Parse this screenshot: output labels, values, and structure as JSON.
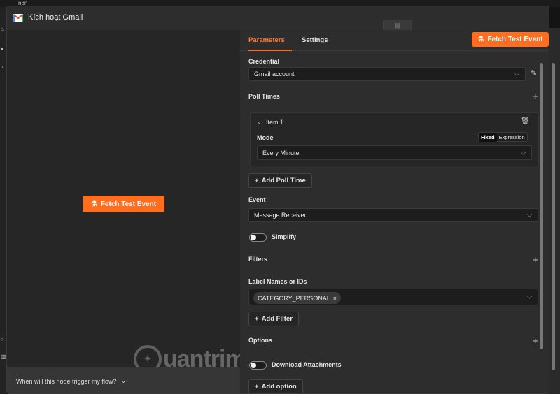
{
  "window": {
    "title": "Kích hoạt Gmail"
  },
  "background": {
    "top_text": "n8n"
  },
  "left_pane": {
    "fetch_button": "Fetch Test Event",
    "faq_text": "When will this node trigger my flow?",
    "watermark": "uantrimang"
  },
  "tabs": [
    {
      "label": "Parameters"
    },
    {
      "label": "Settings"
    }
  ],
  "fetch_button": "Fetch Test Event",
  "credential": {
    "label": "Credential",
    "value": "Gmail account"
  },
  "poll_times": {
    "label": "Poll Times",
    "item_label": "Item 1",
    "mode_label": "Mode",
    "mode_options": [
      "Fixed",
      "Expression"
    ],
    "mode_value": "Every Minute",
    "add_button": "Add Poll Time"
  },
  "event": {
    "label": "Event",
    "value": "Message Received"
  },
  "simplify": {
    "label": "Simplify",
    "enabled": false
  },
  "filters": {
    "label": "Filters",
    "label_names_label": "Label Names or IDs",
    "chip": "CATEGORY_PERSONAL",
    "add_button": "Add Filter"
  },
  "options": {
    "label": "Options",
    "download_label": "Download Attachments",
    "download_enabled": false,
    "add_button": "Add option"
  },
  "colors": {
    "accent": "#ff6d1f",
    "panel": "#2d2d2d",
    "field": "#1d1d1d"
  }
}
